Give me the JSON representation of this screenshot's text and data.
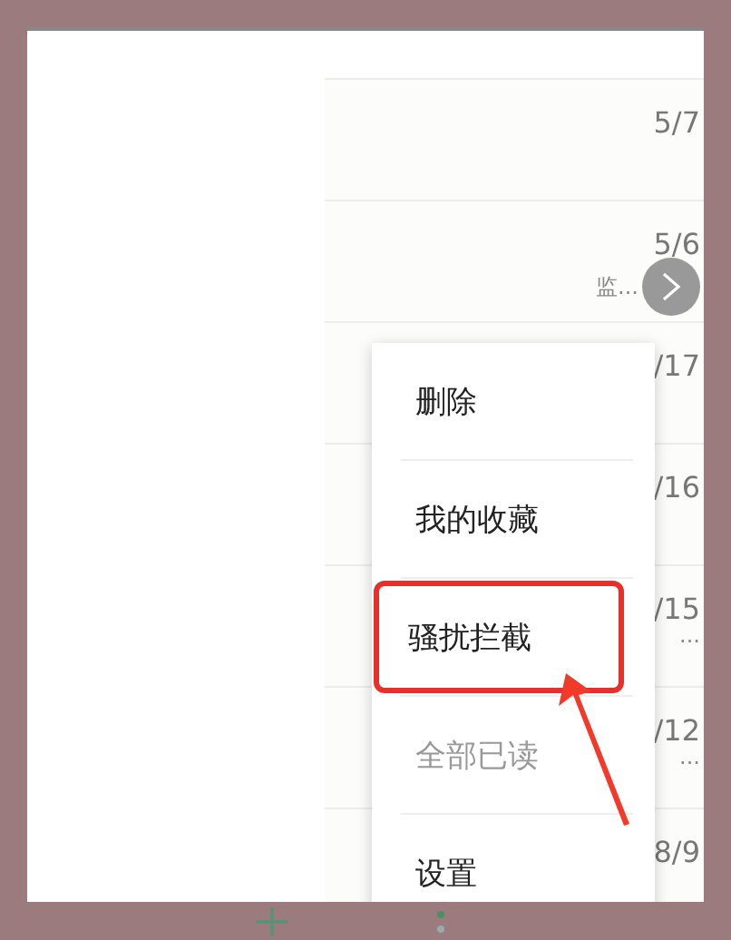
{
  "messages": [
    {
      "date": "5/7"
    },
    {
      "date": "5/6",
      "snippet": "监...",
      "floating_button": true
    },
    {
      "date": "/17"
    },
    {
      "date": "/16"
    },
    {
      "date": "/15",
      "snippet": "..."
    },
    {
      "date": "/12",
      "snippet": "..."
    },
    {
      "date": "8/9"
    }
  ],
  "menu": {
    "items": [
      {
        "label": "删除",
        "disabled": false,
        "highlighted": false
      },
      {
        "label": "我的收藏",
        "disabled": false,
        "highlighted": false
      },
      {
        "label": "骚扰拦截",
        "disabled": false,
        "highlighted": true
      },
      {
        "label": "全部已读",
        "disabled": true,
        "highlighted": false
      },
      {
        "label": "设置",
        "disabled": false,
        "highlighted": false
      }
    ]
  }
}
